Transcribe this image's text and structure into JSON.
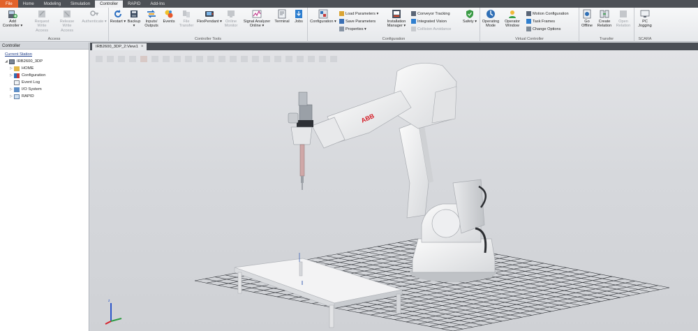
{
  "tabs": [
    {
      "label": "File",
      "active": false
    },
    {
      "label": "Home",
      "active": false
    },
    {
      "label": "Modeling",
      "active": false
    },
    {
      "label": "Simulation",
      "active": false
    },
    {
      "label": "Controller",
      "active": true
    },
    {
      "label": "RAPID",
      "active": false
    },
    {
      "label": "Add-Ins",
      "active": false
    }
  ],
  "ribbon": {
    "access": {
      "label": "Access",
      "add_controller": "Add Controller ▾",
      "request_write": "Request Write Access",
      "release_write": "Release Write Access",
      "authenticate": "Authenticate ▾"
    },
    "controller_tools": {
      "label": "Controller Tools",
      "restart": "Restart ▾",
      "backup": "Backup ▾",
      "inputs_outputs": "Inputs/ Outputs",
      "events": "Events",
      "file_transfer": "File Transfer",
      "flexpendant": "FlexPendant ▾",
      "online_monitor": "Online Monitor",
      "signal_analyzer": "Signal Analyzer Online ▾",
      "terminal": "Terminal",
      "jobs": "Jobs"
    },
    "configuration": {
      "label": "Configuration",
      "configuration": "Configuration ▾",
      "load_parameters": "Load Parameters ▾",
      "save_parameters": "Save Parameters",
      "properties": "Properties ▾",
      "installation_manager": "Installation Manager ▾",
      "conveyor_tracking": "Conveyor Tracking",
      "integrated_vision": "Integrated Vision",
      "collision_avoidance": "Collision Avoidance",
      "safety": "Safety ▾"
    },
    "virtual_controller": {
      "label": "Virtual Controller",
      "operating_mode": "Operating Mode",
      "operator_window": "Operator Window",
      "motion_configuration": "Motion Configuration",
      "task_frames": "Task Frames",
      "change_options": "Change Options"
    },
    "transfer": {
      "label": "Transfer",
      "go_offline": "Go Offline",
      "create_relation": "Create Relation",
      "open_relation": "Open Relation"
    },
    "scara": {
      "label": "SCARA",
      "pc_jogging": "PC Jogging"
    }
  },
  "panel": {
    "title": "Controller",
    "current_station": "Current Station",
    "controller_name": "IRB2600_3DP",
    "items": [
      "HOME",
      "Configuration",
      "Event Log",
      "I/O System",
      "RAPID"
    ]
  },
  "viewport": {
    "tab_title": "IRB2600_3DP_2:View1",
    "close": "×",
    "robot_brand": "ABB"
  },
  "colors": {
    "file_tab": "#e2622a",
    "tabbar_bg": "#4d5156",
    "robot_body": "#f2f2f2",
    "abb_red": "#d5202a",
    "grid": "#2d3035"
  }
}
